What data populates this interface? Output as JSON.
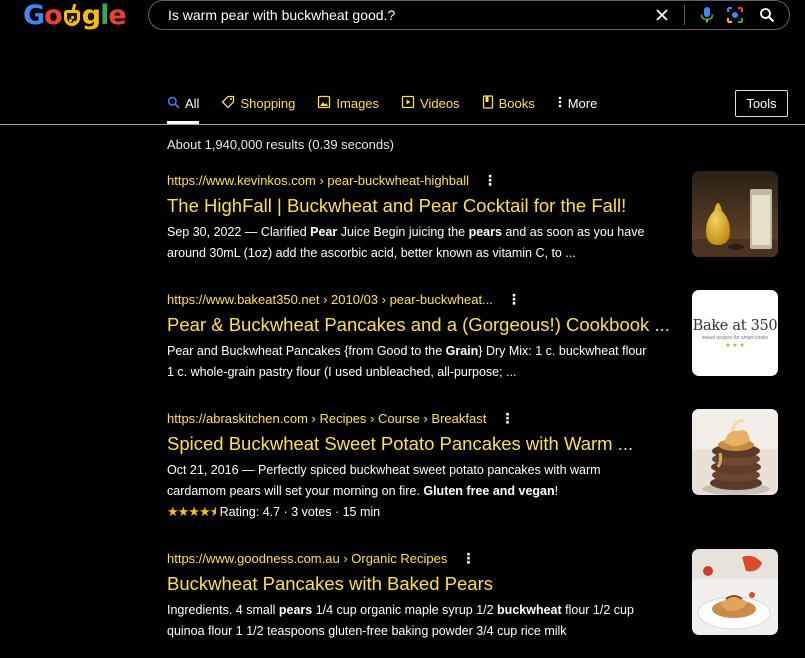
{
  "logo": {
    "letters": [
      "G",
      "o",
      "g",
      "l",
      "e"
    ]
  },
  "search": {
    "query": "Is warm pear with buckwheat good.?"
  },
  "tabs": [
    {
      "label": "All",
      "icon": "search-icon"
    },
    {
      "label": "Shopping",
      "icon": "tag-icon"
    },
    {
      "label": "Images",
      "icon": "image-icon"
    },
    {
      "label": "Videos",
      "icon": "play-icon"
    },
    {
      "label": "Books",
      "icon": "book-icon"
    },
    {
      "label": "More",
      "icon": "more-vert-icon"
    }
  ],
  "tools_label": "Tools",
  "stats": "About 1,940,000 results (0.39 seconds)",
  "colors": {
    "accent": "#fde047",
    "background": "#000000",
    "text": "#ffffff",
    "stars": "#fbbc05"
  },
  "results": [
    {
      "url": "https://www.kevinkos.com › pear-buckwheat-highball",
      "title": "The HighFall | Buckwheat and Pear Cocktail for the Fall!",
      "snippet": [
        {
          "t": "Sep 30, 2022 — Clarified ",
          "b": false
        },
        {
          "t": "Pear",
          "b": true
        },
        {
          "t": " Juice Begin juicing the ",
          "b": false
        },
        {
          "t": "pears",
          "b": true
        },
        {
          "t": " and as soon as you have around 30mL (1oz) add the ascorbic acid, better known as vitamin C, to ...",
          "b": false
        }
      ],
      "thumb": "pear-cocktail"
    },
    {
      "url": "https://www.bakeat350.net › 2010/03 › pear-buckwheat...",
      "title": "Pear & Buckwheat Pancakes and a (Gorgeous!) Cookbook ...",
      "snippet": [
        {
          "t": "Pear and Buckwheat Pancakes {from Good to the ",
          "b": false
        },
        {
          "t": "Grain",
          "b": true
        },
        {
          "t": "} Dry Mix: 1 c. buckwheat flour 1 c. whole-grain pastry flour (I used unbleached, all-purpose; ...",
          "b": false
        }
      ],
      "thumb": "bake-at-350",
      "thumb_text": "Bake at 350",
      "thumb_subtext": "sweet recipes for smart cooks"
    },
    {
      "url": "https://abraskitchen.com › Recipes › Course › Breakfast",
      "title": "Spiced Buckwheat Sweet Potato Pancakes with Warm ...",
      "snippet": [
        {
          "t": "Oct 21, 2016 — Perfectly spiced buckwheat sweet potato pancakes with warm cardamom pears will set your morning on fire. ",
          "b": false
        },
        {
          "t": "Gluten free and vegan",
          "b": true
        },
        {
          "t": "!",
          "b": false
        }
      ],
      "rating": {
        "stars": 4.7,
        "text": "Rating: 4.7 · 3 votes · 15 min"
      },
      "thumb": "pancake-stack"
    },
    {
      "url": "https://www.goodness.com.au › Organic Recipes",
      "title": "Buckwheat Pancakes with Baked Pears",
      "snippet": [
        {
          "t": "Ingredients. 4 small ",
          "b": false
        },
        {
          "t": "pears",
          "b": true
        },
        {
          "t": " 1/4 cup organic maple syrup 1/2 ",
          "b": false
        },
        {
          "t": "buckwheat",
          "b": true
        },
        {
          "t": " flour 1/2 cup quinoa flour 1 1/2 teaspoons gluten-free baking powder 3/4 cup rice milk",
          "b": false
        }
      ],
      "thumb": "pancake-plate"
    }
  ]
}
